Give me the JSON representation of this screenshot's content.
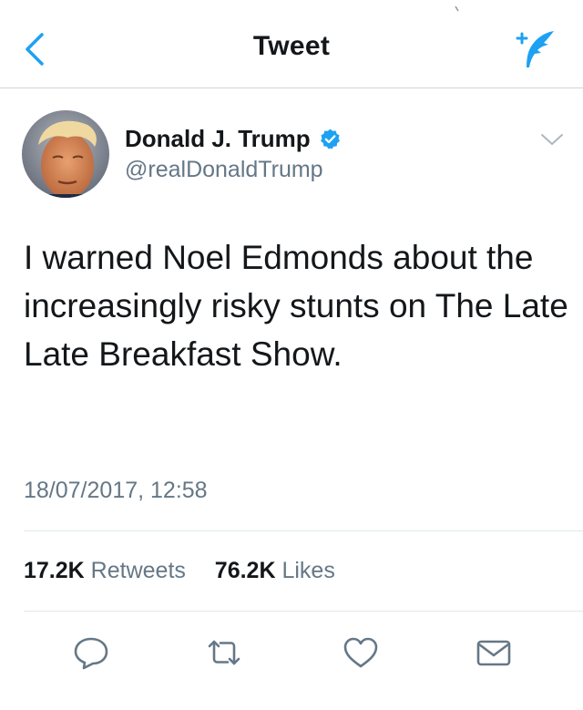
{
  "nav": {
    "title": "Tweet",
    "back_icon": "chevron-left-icon",
    "compose_icon": "compose-tweet-icon",
    "accent_color": "#1da1f2"
  },
  "tweet": {
    "author_name": "Donald J. Trump",
    "handle": "@realDonaldTrump",
    "verified": true,
    "text": "I warned Noel Edmonds about the increasingly risky stunts on The Late Late Breakfast Show.",
    "timestamp": "18/07/2017, 12:58"
  },
  "stats": {
    "retweets_count": "17.2K",
    "retweets_label": "Retweets",
    "likes_count": "76.2K",
    "likes_label": "Likes"
  },
  "actions": [
    {
      "icon": "reply-icon"
    },
    {
      "icon": "retweet-icon"
    },
    {
      "icon": "heart-icon"
    },
    {
      "icon": "direct-message-icon"
    }
  ],
  "colors": {
    "text_primary": "#14171a",
    "text_secondary": "#657786",
    "divider": "#e1e8ed",
    "verified": "#1da1f2"
  }
}
